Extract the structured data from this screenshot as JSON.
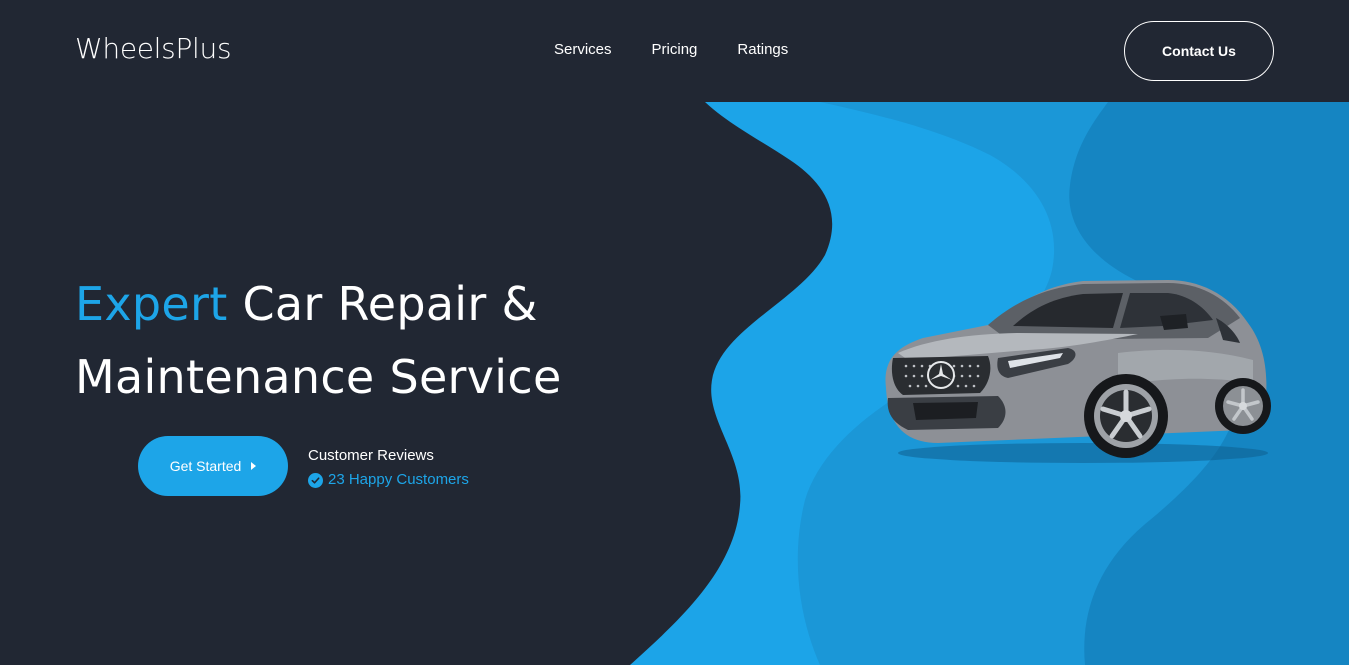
{
  "brand": {
    "logo": "WheelsPlus"
  },
  "nav": {
    "items": [
      {
        "label": "Services"
      },
      {
        "label": "Pricing"
      },
      {
        "label": "Ratings"
      }
    ],
    "contact_label": "Contact Us"
  },
  "hero": {
    "title_accent": "Expert",
    "title_rest_line1": "Car Repair &",
    "title_line2": "Maintenance Service",
    "cta_label": "Get Started",
    "cta_icon": "caret-right-icon",
    "reviews_title": "Customer Reviews",
    "reviews_count_text": "23 Happy Customers",
    "reviews_icon": "check-circle-icon",
    "image": "car-image"
  },
  "colors": {
    "background": "#212733",
    "accent": "#1da5e8",
    "wave_light": "#1ca4e8",
    "wave_mid": "#1b97d7",
    "wave_dark": "#1585c2",
    "text": "#ffffff"
  }
}
